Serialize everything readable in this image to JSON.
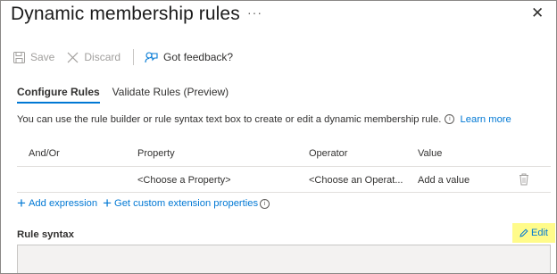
{
  "panel": {
    "title": "Dynamic membership rules",
    "more_label": "···",
    "close_glyph": "✕"
  },
  "toolbar": {
    "save_label": "Save",
    "discard_label": "Discard",
    "feedback_label": "Got feedback?"
  },
  "tabs": [
    {
      "label": "Configure Rules",
      "active": true
    },
    {
      "label": "Validate Rules (Preview)",
      "active": false
    }
  ],
  "description": {
    "text": "You can use the rule builder or rule syntax text box to create or edit a dynamic membership rule.",
    "learn_more": "Learn more"
  },
  "rule_table": {
    "headers": [
      "And/Or",
      "Property",
      "Operator",
      "Value"
    ],
    "rows": [
      {
        "and_or": "",
        "property": "<Choose a Property>",
        "operator": "<Choose an Operat...",
        "value": "Add a value"
      }
    ]
  },
  "actions": {
    "add_expression": "Add expression",
    "get_custom_extension": "Get custom extension properties"
  },
  "rule_syntax": {
    "label": "Rule syntax",
    "edit_label": "Edit",
    "value": ""
  },
  "colors": {
    "accent": "#0078d4",
    "highlight": "#fffb8a",
    "disabled": "#a19f9d"
  }
}
